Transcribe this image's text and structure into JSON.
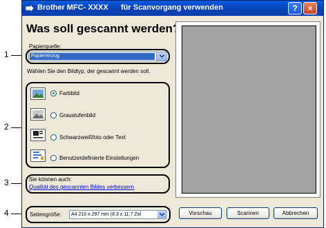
{
  "window": {
    "title": "Brother MFC- XXXX      für Scanvorgang verwenden",
    "help_label": "?",
    "close_label": "×"
  },
  "heading": "Was soll gescannt werden?",
  "paper_source": {
    "label": "Papierquelle:",
    "value": "Papiereinzug"
  },
  "image_type": {
    "prompt": "Wählen Sie den Bildtyp, der gescannt werden soll.",
    "options": [
      {
        "label": "Farbbild",
        "icon": "color-photo-icon",
        "selected": true
      },
      {
        "label": "Graustufenbild",
        "icon": "grayscale-photo-icon",
        "selected": false
      },
      {
        "label": "Schwarzweißfoto oder Text",
        "icon": "bw-text-icon",
        "selected": false
      },
      {
        "label": "Benutzerdefinierte Einstellungen",
        "icon": "custom-settings-icon",
        "selected": false
      }
    ]
  },
  "more": {
    "label": "Sie können auch:",
    "link": "Qualität des gescannten Bildes verbessern"
  },
  "page_size": {
    "label": "Seitengröße:",
    "value": "A4 210 x 297 mm (8.3 x 11.7 Zol"
  },
  "buttons": {
    "preview": "Vorschau",
    "scan": "Scannen",
    "cancel": "Abbrechen"
  },
  "callouts": [
    "1",
    "2",
    "3",
    "4"
  ],
  "colors": {
    "titlebar": "#0a5be0",
    "selection": "#316ac5",
    "preview_gray": "#a2a2a2",
    "link": "#0000ee"
  }
}
